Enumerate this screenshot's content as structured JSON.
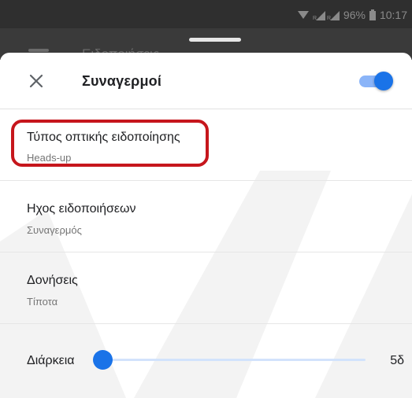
{
  "status_bar": {
    "battery": "96%",
    "time": "10:17"
  },
  "background_app": {
    "title": "Ειδοποιήσεις"
  },
  "sheet": {
    "title": "Συναγερμοί",
    "toggle_on": true
  },
  "settings": [
    {
      "label": "Τύπος οπτικής ειδοποίησης",
      "value": "Heads-up",
      "highlighted": true
    },
    {
      "label": "Ηχος ειδοποιήσεων",
      "value": "Συναγερμός"
    },
    {
      "label": "Δονήσεις",
      "value": "Τίποτα"
    }
  ],
  "duration": {
    "label": "Διάρκεια",
    "value_text": "5δ",
    "slider_fraction": 0.0
  },
  "colors": {
    "accent": "#1a73e8",
    "highlight_border": "#c6161c"
  }
}
